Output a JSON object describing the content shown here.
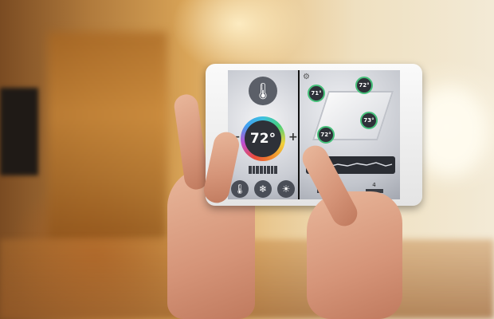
{
  "thermostat": {
    "current_temp": "72°",
    "decrease_label": "−",
    "increase_label": "+",
    "icons": [
      "thermometer-icon",
      "snowflake-icon",
      "sun-icon"
    ]
  },
  "rooms": [
    {
      "temp": "71°"
    },
    {
      "temp": "72°"
    },
    {
      "temp": "73°"
    },
    {
      "temp": "72°"
    }
  ],
  "zones": [
    {
      "number": "3"
    },
    {
      "number": "4"
    }
  ],
  "colors": {
    "accent_green": "#46c07a",
    "dark_ui": "#2e3138"
  }
}
